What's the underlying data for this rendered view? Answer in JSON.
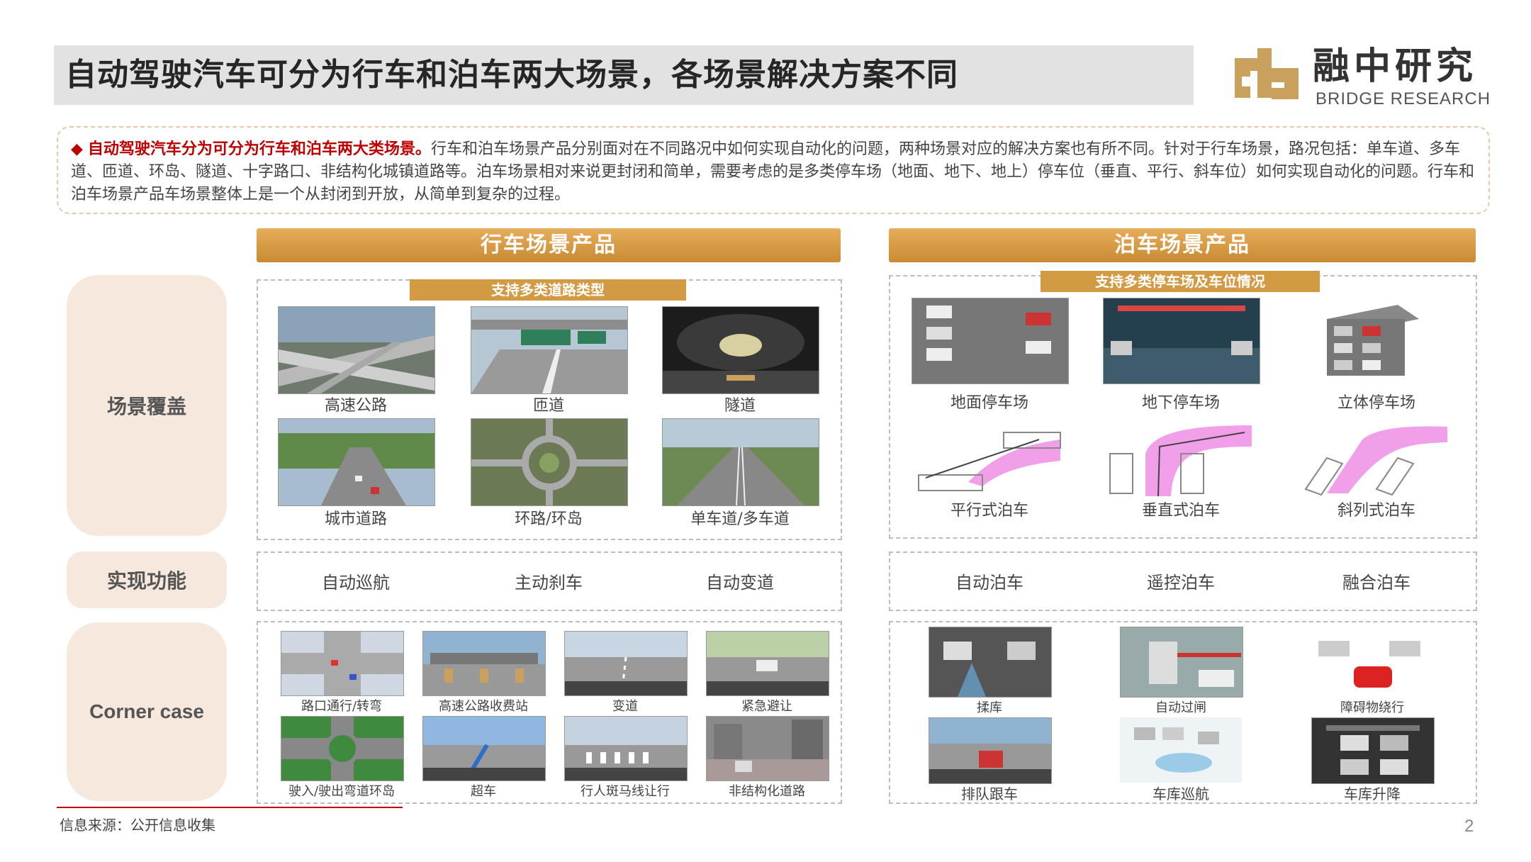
{
  "title": "自动驾驶汽车可分为行车和泊车两大场景，各场景解决方案不同",
  "logo": {
    "cn": "融中研究",
    "en": "BRIDGE RESEARCH",
    "color": "#c9a15c"
  },
  "intro": {
    "bullet": "◆",
    "highlight": "自动驾驶汽车分为可分为行车和泊车两大类场景。",
    "text": "行车和泊车场景产品分别面对在不同路况中如何实现自动化的问题，两种场景对应的解决方案也有所不同。针对于行车场景，路况包括：单车道、多车道、匝道、环岛、隧道、十字路口、非结构化城镇道路等。泊车场景相对来说更封闭和简单，需要考虑的是多类停车场（地面、地下、地上）停车位（垂直、平行、斜车位）如何实现自动化的问题。行车和泊车场景产品车场景整体上是一个从封闭到开放，从简单到复杂的过程。"
  },
  "row_labels": {
    "scene": "场景覆盖",
    "function": "实现功能",
    "corner": "Corner case"
  },
  "driving": {
    "header": "行车场景产品",
    "sub_header": "支持多类道路类型",
    "scenes": [
      "高速公路",
      "匝道",
      "隧道",
      "城市道路",
      "环路/环岛",
      "单车道/多车道"
    ],
    "functions": [
      "自动巡航",
      "主动刹车",
      "自动变道"
    ],
    "corner_cases": [
      "路口通行/转弯",
      "高速公路收费站",
      "变道",
      "紧急避让",
      "驶入/驶出弯道环岛",
      "超车",
      "行人斑马线让行",
      "非结构化道路"
    ]
  },
  "parking": {
    "header": "泊车场景产品",
    "sub_header": "支持多类停车场及车位情况",
    "scenes": [
      "地面停车场",
      "地下停车场",
      "立体停车场",
      "平行式泊车",
      "垂直式泊车",
      "斜列式泊车"
    ],
    "functions": [
      "自动泊车",
      "遥控泊车",
      "融合泊车"
    ],
    "corner_cases": [
      "揉库",
      "自动过闸",
      "障碍物绕行",
      "排队跟车",
      "车库巡航",
      "车库升降"
    ]
  },
  "source": "信息来源：公开信息收集",
  "page_number": "2",
  "colors": {
    "accent": "#d39a44",
    "highlight": "#c00000",
    "label_bg": "#f6e8dd",
    "title_bg": "#e2e2e2"
  }
}
